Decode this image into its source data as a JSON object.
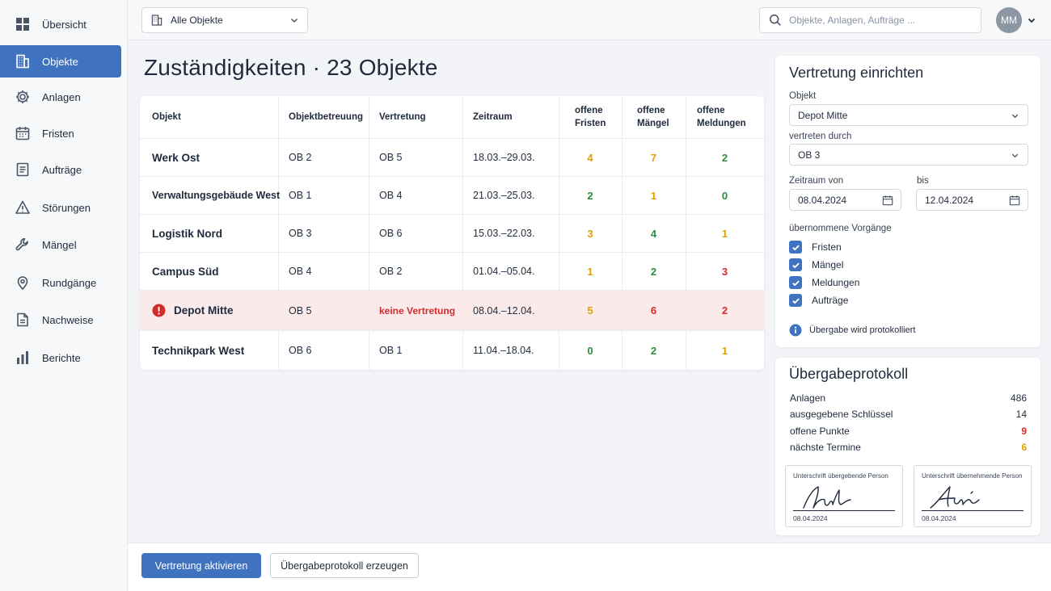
{
  "sidebar": {
    "items": [
      {
        "label": "Übersicht",
        "icon": "dashboard-icon"
      },
      {
        "label": "Objekte",
        "icon": "building-icon",
        "active": true
      },
      {
        "label": "Anlagen",
        "icon": "gear-icon"
      },
      {
        "label": "Fristen",
        "icon": "calendar-icon"
      },
      {
        "label": "Aufträge",
        "icon": "document-list-icon"
      },
      {
        "label": "Störungen",
        "icon": "warning-icon"
      },
      {
        "label": "Mängel",
        "icon": "wrench-icon"
      },
      {
        "label": "Rundgänge",
        "icon": "map-pin-icon"
      },
      {
        "label": "Nachweise",
        "icon": "file-icon"
      },
      {
        "label": "Berichte",
        "icon": "bar-chart-icon"
      }
    ]
  },
  "topbar": {
    "object_filter": "Alle Objekte",
    "search_placeholder": "Objekte, Anlagen, Aufträge ...",
    "avatar_initials": "MM"
  },
  "main": {
    "title": "Zuständigkeiten · 23 Objekte"
  },
  "table": {
    "headers": {
      "objekt": "Objekt",
      "objektbetreuung": "Objektbetreuung",
      "vertretung": "Vertretung",
      "zeitraum": "Zeitraum",
      "fristen_1": "offene",
      "fristen_2": "Fristen",
      "maengel_1": "offene",
      "maengel_2": "Mängel",
      "meldungen_1": "offene",
      "meldungen_2": "Meldungen"
    },
    "rows": [
      {
        "objekt": "Werk Ost",
        "ob": "OB 2",
        "vertretung": "OB 5",
        "zeitraum": "18.03.–29.03.",
        "fristen": "4",
        "maengel": "7",
        "meldungen": "2"
      },
      {
        "objekt": "Verwaltungsgebäude West",
        "ob": "OB 1",
        "vertretung": "OB 4",
        "zeitraum": "21.03.–25.03.",
        "fristen": "2",
        "maengel": "1",
        "meldungen": "0"
      },
      {
        "objekt": "Logistik Nord",
        "ob": "OB 3",
        "vertretung": "OB 6",
        "zeitraum": "15.03.–22.03.",
        "fristen": "3",
        "maengel": "4",
        "meldungen": "1"
      },
      {
        "objekt": "Campus Süd",
        "ob": "OB 4",
        "vertretung": "OB 2",
        "zeitraum": "01.04.–05.04.",
        "fristen": "1",
        "maengel": "2",
        "meldungen": "3"
      },
      {
        "objekt": "Depot Mitte",
        "ob": "OB 5",
        "vertretung": "keine Vertretung",
        "zeitraum": "08.04.–12.04.",
        "fristen": "5",
        "maengel": "6",
        "meldungen": "2",
        "alert": true
      },
      {
        "objekt": "Technikpark West",
        "ob": "OB 6",
        "vertretung": "OB 1",
        "zeitraum": "11.04.–18.04.",
        "fristen": "0",
        "maengel": "2",
        "meldungen": "1"
      }
    ]
  },
  "vertretung_form": {
    "title": "Vertretung einrichten",
    "objekt_label": "Objekt",
    "objekt_value": "Depot Mitte",
    "vertreten_label": "vertreten durch",
    "vertreten_value": "OB 3",
    "von_label": "Zeitraum von",
    "von_value": "08.04.2024",
    "bis_label": "bis",
    "bis_value": "12.04.2024",
    "vorgaenge_label": "übernommene Vorgänge",
    "checkboxes": [
      "Fristen",
      "Mängel",
      "Meldungen",
      "Aufträge"
    ],
    "info_text": "Übergabe wird protokolliert"
  },
  "protokoll": {
    "title": "Übergabeprotokoll",
    "rows": [
      {
        "label": "Anlagen",
        "value": "486"
      },
      {
        "label": "ausgegebene Schlüssel",
        "value": "14"
      },
      {
        "label": "offene Punkte",
        "value": "9"
      },
      {
        "label": "nächste Termine",
        "value": "6"
      }
    ],
    "sig_left_caption": "Unterschrift übergebende Person",
    "sig_left_date": "08.04.2024",
    "sig_right_caption": "Unterschrift übernehmende Person",
    "sig_right_date": "08.04.2024"
  },
  "actions": {
    "primary": "Vertretung aktivieren",
    "secondary": "Übergabeprotokoll erzeugen"
  },
  "colors": {
    "accent": "#3f73bf",
    "yellow": "#e0a100",
    "green": "#2e8b3e",
    "red": "#d42b2b",
    "alert_row": "#fbeaea"
  }
}
